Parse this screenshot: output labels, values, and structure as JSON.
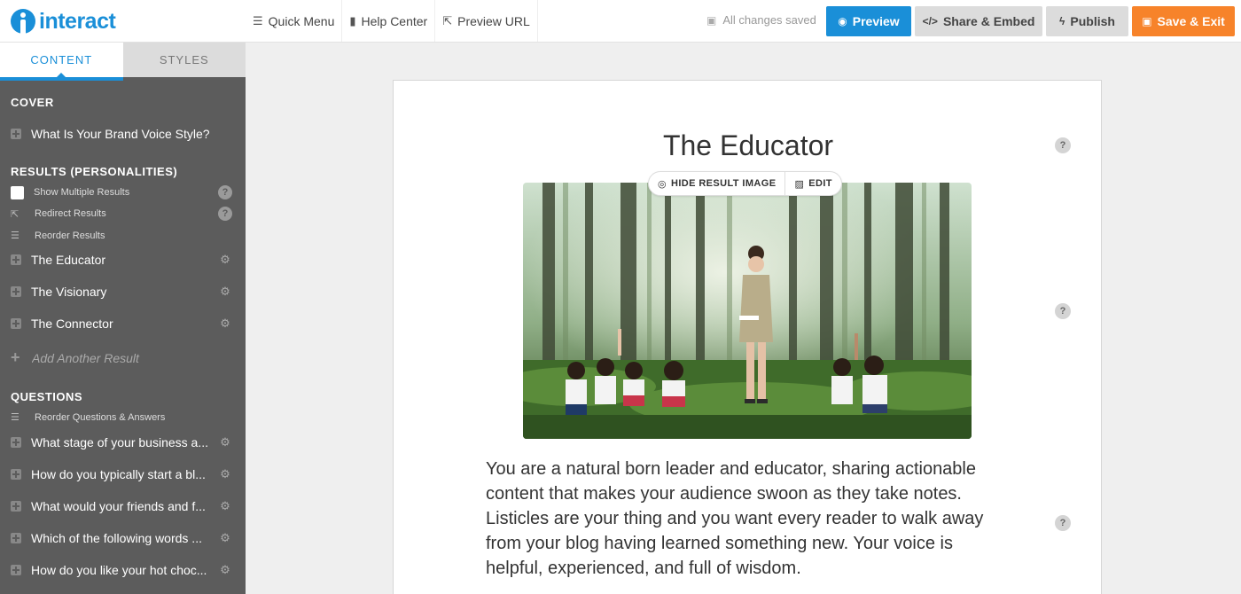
{
  "header": {
    "logo_text": "interact",
    "quick_menu": "Quick Menu",
    "help_center": "Help Center",
    "preview_url": "Preview URL",
    "saved_status": "All changes saved",
    "preview": "Preview",
    "share_embed": "Share & Embed",
    "publish": "Publish",
    "save_exit": "Save & Exit"
  },
  "sidebar": {
    "tabs": {
      "content": "CONTENT",
      "styles": "STYLES"
    },
    "cover_heading": "COVER",
    "cover_item": "What Is Your Brand Voice Style?",
    "results_heading": "RESULTS (PERSONALITIES)",
    "show_multiple": "Show Multiple Results",
    "redirect": "Redirect Results",
    "reorder_results": "Reorder Results",
    "results": [
      "The Educator",
      "The Visionary",
      "The Connector"
    ],
    "add_result": "Add Another Result",
    "questions_heading": "QUESTIONS",
    "reorder_questions": "Reorder Questions & Answers",
    "questions": [
      "What stage of your business a...",
      "How do you typically start a bl...",
      "What would your friends and f...",
      "Which of the following words ...",
      "How do you like your hot choc..."
    ]
  },
  "main": {
    "title": "The Educator",
    "hide_image": "HIDE RESULT IMAGE",
    "edit": "EDIT",
    "help_glyph": "?",
    "description": "You are a natural born leader and educator, sharing actionable content that makes your audience swoon as they take notes. Listicles are your thing and you want every reader to walk away from your blog having learned something new. Your voice is helpful, experienced, and full of wisdom."
  },
  "colors": {
    "accent": "#1a8fd8",
    "save": "#f7832a",
    "sidebar": "#5c5c5c"
  }
}
